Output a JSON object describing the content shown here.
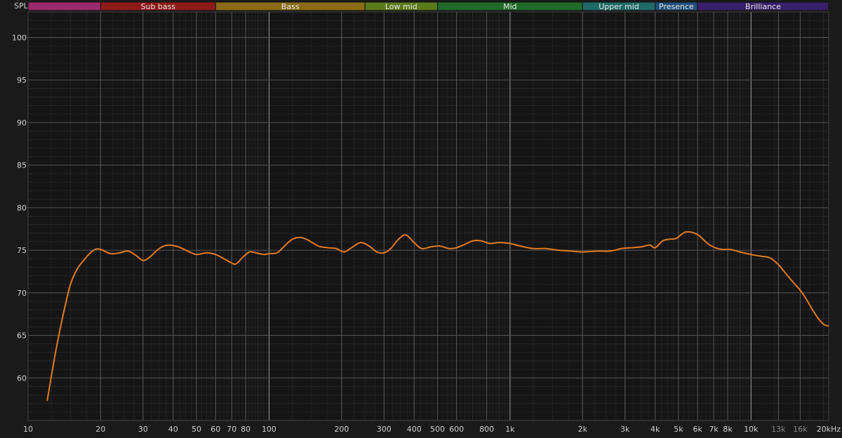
{
  "chart_data": {
    "type": "line",
    "title": "",
    "xlabel": "",
    "ylabel": "SPL",
    "x_unit_label": "20kHz",
    "x_scale": "log",
    "xlim": [
      10,
      21000
    ],
    "ylim": [
      55,
      103
    ],
    "grid": true,
    "colors": {
      "background": "#1a1a1a",
      "plot_background": "#151515",
      "major_grid": "#555555",
      "minor_grid": "#2e2e2e",
      "decade_line": "#9a9a9a",
      "curve": "#e07b22"
    },
    "bands": [
      {
        "label": "",
        "from": 10,
        "to": 20,
        "color": "#9a2a6e"
      },
      {
        "label": "Sub bass",
        "from": 20,
        "to": 60,
        "color": "#8f1a1a"
      },
      {
        "label": "Bass",
        "from": 60,
        "to": 250,
        "color": "#8a6a14"
      },
      {
        "label": "Low mid",
        "from": 250,
        "to": 500,
        "color": "#5b7a1a"
      },
      {
        "label": "Mid",
        "from": 500,
        "to": 2000,
        "color": "#1f6a2a"
      },
      {
        "label": "Upper mid",
        "from": 2000,
        "to": 4000,
        "color": "#1f6a66"
      },
      {
        "label": "Presence",
        "from": 4000,
        "to": 6000,
        "color": "#1f4f7a"
      },
      {
        "label": "Brilliance",
        "from": 6000,
        "to": 21000,
        "color": "#3a1f6a"
      }
    ],
    "y_ticks": [
      60,
      65,
      70,
      75,
      80,
      85,
      90,
      95,
      100
    ],
    "x_ticks": [
      {
        "value": 10,
        "label": "10"
      },
      {
        "value": 20,
        "label": "20"
      },
      {
        "value": 30,
        "label": "30"
      },
      {
        "value": 40,
        "label": "40"
      },
      {
        "value": 50,
        "label": "50"
      },
      {
        "value": 60,
        "label": "60"
      },
      {
        "value": 70,
        "label": "70"
      },
      {
        "value": 80,
        "label": "80"
      },
      {
        "value": 100,
        "label": "100"
      },
      {
        "value": 200,
        "label": "200"
      },
      {
        "value": 300,
        "label": "300"
      },
      {
        "value": 400,
        "label": "400"
      },
      {
        "value": 500,
        "label": "500"
      },
      {
        "value": 600,
        "label": "600"
      },
      {
        "value": 800,
        "label": "800"
      },
      {
        "value": 1000,
        "label": "1k"
      },
      {
        "value": 2000,
        "label": "2k"
      },
      {
        "value": 3000,
        "label": "3k"
      },
      {
        "value": 4000,
        "label": "4k"
      },
      {
        "value": 5000,
        "label": "5k"
      },
      {
        "value": 6000,
        "label": "6k"
      },
      {
        "value": 7000,
        "label": "7k"
      },
      {
        "value": 8000,
        "label": "8k"
      },
      {
        "value": 10000,
        "label": "10k"
      },
      {
        "value": 13000,
        "label": "13k",
        "dim": true
      },
      {
        "value": 16000,
        "label": "16k",
        "dim": true
      }
    ],
    "series": [
      {
        "points": [
          [
            12,
            57.3
          ],
          [
            13,
            63
          ],
          [
            14,
            67.5
          ],
          [
            15,
            71
          ],
          [
            16,
            72.8
          ],
          [
            17,
            73.8
          ],
          [
            18,
            74.6
          ],
          [
            19,
            75.1
          ],
          [
            20,
            75.1
          ],
          [
            22,
            74.6
          ],
          [
            24,
            74.7
          ],
          [
            26,
            74.9
          ],
          [
            28,
            74.4
          ],
          [
            30,
            73.8
          ],
          [
            32,
            74.2
          ],
          [
            35,
            75.2
          ],
          [
            38,
            75.6
          ],
          [
            42,
            75.4
          ],
          [
            46,
            74.9
          ],
          [
            50,
            74.5
          ],
          [
            55,
            74.7
          ],
          [
            60,
            74.5
          ],
          [
            65,
            74
          ],
          [
            70,
            73.5
          ],
          [
            73,
            73.4
          ],
          [
            78,
            74.2
          ],
          [
            83,
            74.8
          ],
          [
            88,
            74.7
          ],
          [
            95,
            74.5
          ],
          [
            100,
            74.6
          ],
          [
            108,
            74.7
          ],
          [
            115,
            75.4
          ],
          [
            125,
            76.3
          ],
          [
            135,
            76.5
          ],
          [
            145,
            76.2
          ],
          [
            160,
            75.5
          ],
          [
            175,
            75.3
          ],
          [
            190,
            75.2
          ],
          [
            205,
            74.8
          ],
          [
            220,
            75.3
          ],
          [
            240,
            75.9
          ],
          [
            260,
            75.5
          ],
          [
            280,
            74.8
          ],
          [
            300,
            74.7
          ],
          [
            320,
            75.2
          ],
          [
            345,
            76.3
          ],
          [
            370,
            76.8
          ],
          [
            400,
            75.9
          ],
          [
            430,
            75.2
          ],
          [
            470,
            75.4
          ],
          [
            510,
            75.5
          ],
          [
            560,
            75.2
          ],
          [
            600,
            75.3
          ],
          [
            650,
            75.7
          ],
          [
            700,
            76.1
          ],
          [
            760,
            76.1
          ],
          [
            820,
            75.8
          ],
          [
            900,
            75.9
          ],
          [
            1000,
            75.8
          ],
          [
            1100,
            75.5
          ],
          [
            1250,
            75.2
          ],
          [
            1400,
            75.2
          ],
          [
            1600,
            75
          ],
          [
            1800,
            74.9
          ],
          [
            2000,
            74.8
          ],
          [
            2300,
            74.9
          ],
          [
            2600,
            74.9
          ],
          [
            2900,
            75.2
          ],
          [
            3200,
            75.3
          ],
          [
            3500,
            75.4
          ],
          [
            3800,
            75.6
          ],
          [
            4000,
            75.3
          ],
          [
            4300,
            76.1
          ],
          [
            4600,
            76.3
          ],
          [
            4900,
            76.4
          ],
          [
            5300,
            77.1
          ],
          [
            5700,
            77.1
          ],
          [
            6100,
            76.7
          ],
          [
            6600,
            75.8
          ],
          [
            7100,
            75.3
          ],
          [
            7600,
            75.1
          ],
          [
            8200,
            75.1
          ],
          [
            9000,
            74.8
          ],
          [
            10000,
            74.5
          ],
          [
            11000,
            74.3
          ],
          [
            12000,
            74.1
          ],
          [
            13000,
            73.3
          ],
          [
            14000,
            72.2
          ],
          [
            15000,
            71.2
          ],
          [
            16000,
            70.3
          ],
          [
            17000,
            69.2
          ],
          [
            18000,
            68
          ],
          [
            19000,
            67
          ],
          [
            20000,
            66.3
          ],
          [
            21000,
            66.1
          ]
        ]
      }
    ]
  }
}
